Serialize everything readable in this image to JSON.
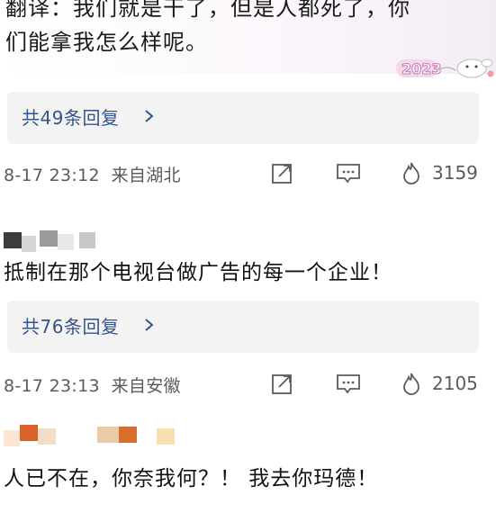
{
  "top_comment": {
    "line1": "翻译：我们就是干了，但是人都死了，你",
    "line2": "们能拿我怎么样呢。",
    "sticker_text": "2023"
  },
  "thread1": {
    "reply_label": "共49条回复",
    "timestamp": "8-17 23:12",
    "location": "来自湖北",
    "likes": "3159"
  },
  "thread2": {
    "comment": "抵制在那个电视台做广告的每一个企业！",
    "reply_label": "共76条回复",
    "timestamp": "8-17 23:13",
    "location": "来自安徽",
    "likes": "2105"
  },
  "thread3": {
    "comment": "人已不在，你奈我何？！  我去你玛德！"
  },
  "icons": [
    "share-icon",
    "comment-icon",
    "like-flame-icon",
    "chevron-right-icon"
  ],
  "colors": {
    "link": "#34558b",
    "meta": "#5b5b5b",
    "reply_bg": "#f3f3f3"
  }
}
